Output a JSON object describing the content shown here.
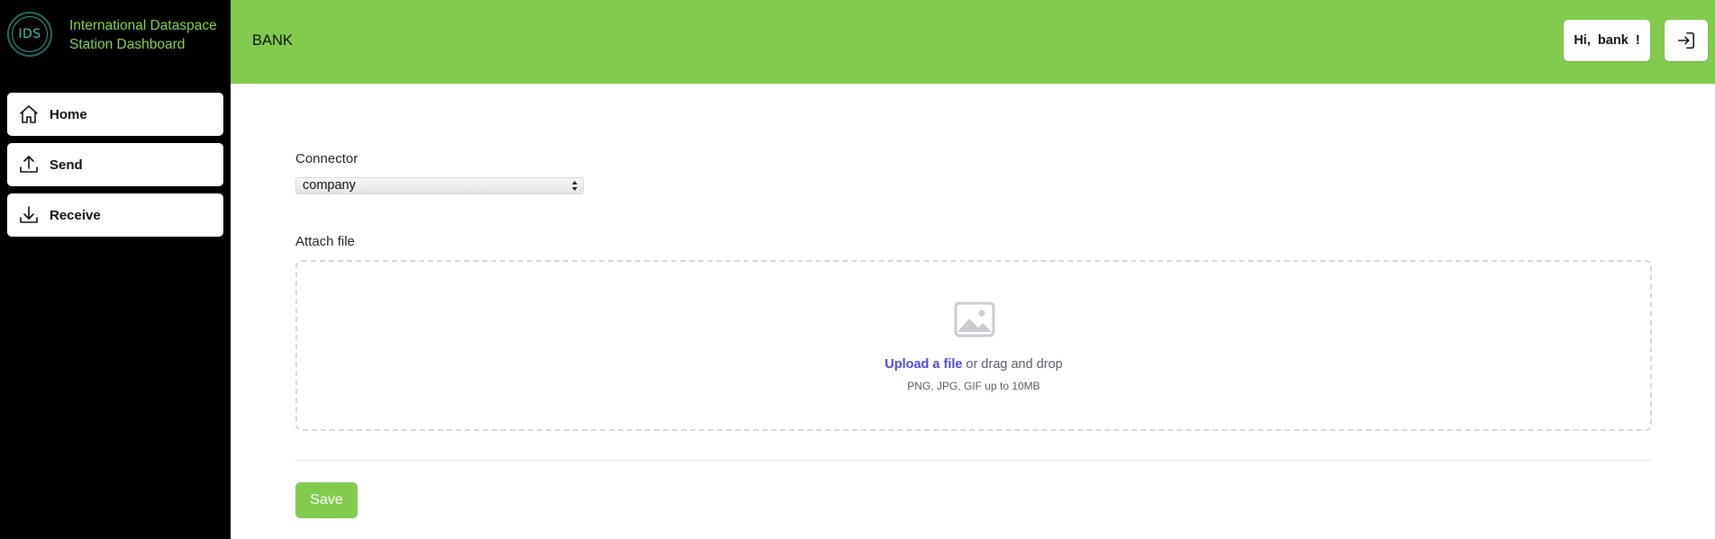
{
  "brand": {
    "logo_text": "IDS",
    "title": "International Dataspace Station Dashboard"
  },
  "sidebar": {
    "items": [
      {
        "label": "Home",
        "icon": "home-icon"
      },
      {
        "label": "Send",
        "icon": "upload-icon"
      },
      {
        "label": "Receive",
        "icon": "download-icon"
      }
    ]
  },
  "header": {
    "page_name": "BANK",
    "greeting_prefix": "Hi,",
    "user": "bank",
    "greeting_suffix": "!",
    "logout_icon": "logout-icon"
  },
  "form": {
    "connector_label": "Connector",
    "connector_value": "company",
    "attach_label": "Attach file",
    "upload_link": "Upload a file",
    "upload_rest": "or drag and drop",
    "hint": "PNG, JPG, GIF up to 10MB",
    "save_label": "Save"
  },
  "colors": {
    "accent": "#83cb4f",
    "sidebar_bg": "#000000",
    "brand_text": "#8bd548",
    "link": "#4f46e5"
  }
}
